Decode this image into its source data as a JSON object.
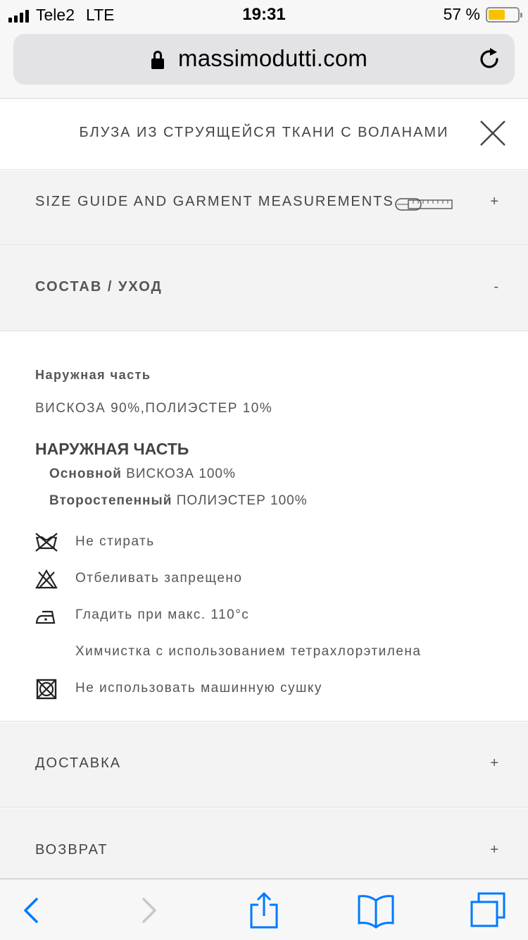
{
  "status_bar": {
    "carrier": "Tele2",
    "network": "LTE",
    "time": "19:31",
    "battery_text": "57 %",
    "battery_level": 0.57,
    "battery_color": "#f7c300"
  },
  "url_bar": {
    "url": "massimodutti.com",
    "lock_icon": "lock-icon",
    "reload_icon": "reload-icon"
  },
  "product": {
    "title": "БЛУЗА ИЗ СТРУЯЩЕЙСЯ ТКАНИ С ВОЛАНАМИ",
    "close_icon": "close-icon"
  },
  "accordion": {
    "size_guide": {
      "label": "SIZE GUIDE AND GARMENT MEASUREMENTS",
      "sign": "+",
      "icon": "measuring-tape-icon"
    },
    "composition": {
      "label": "СОСТАВ / УХОД",
      "sign": "-"
    },
    "delivery": {
      "label": "ДОСТАВКА",
      "sign": "+"
    },
    "returns": {
      "label": "ВОЗВРАТ",
      "sign": "+"
    }
  },
  "composition": {
    "subtitle": "Наружная часть",
    "fabric": "ВИСКОЗА 90%,ПОЛИЭСТЕР 10%",
    "heading": "НАРУЖНАЯ ЧАСТЬ",
    "lines": [
      {
        "label": "Основной",
        "value": "ВИСКОЗА 100%"
      },
      {
        "label": "Второстепенный",
        "value": "ПОЛИЭСТЕР 100%"
      }
    ]
  },
  "care": [
    {
      "icon": "no-wash-icon",
      "text": "Не стирать"
    },
    {
      "icon": "no-bleach-icon",
      "text": "Отбеливать запрещено"
    },
    {
      "icon": "iron-low-icon",
      "text": "Гладить при макс. 110°c"
    },
    {
      "icon": "",
      "text": "Химчистка с использованием тетрахлорэтилена"
    },
    {
      "icon": "no-tumble-dry-icon",
      "text": "Не использовать машинную сушку"
    }
  ],
  "toolbar": {
    "back_icon": "back-arrow-icon",
    "forward_icon": "forward-arrow-icon",
    "share_icon": "share-icon",
    "bookmarks_icon": "bookmarks-icon",
    "tabs_icon": "tabs-icon",
    "accent": "#007aff"
  }
}
